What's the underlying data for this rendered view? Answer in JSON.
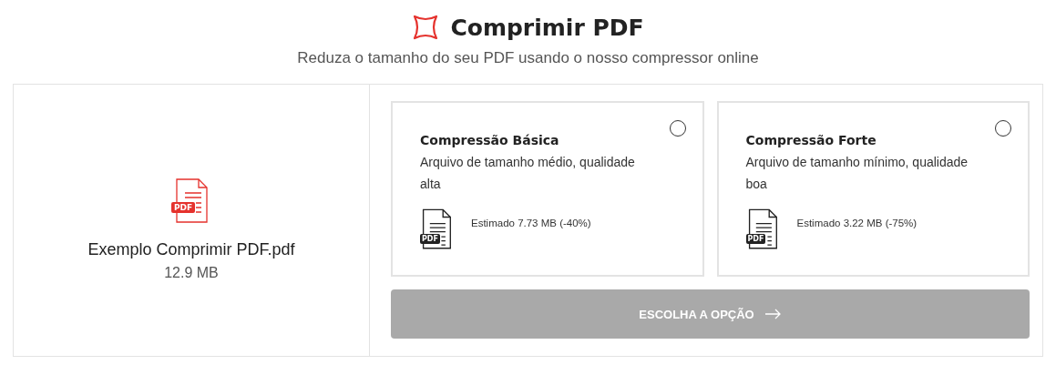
{
  "header": {
    "title": "Comprimir PDF",
    "subtitle": "Reduza o tamanho do seu PDF usando o nosso compressor online"
  },
  "file": {
    "badge": "PDF",
    "name": "Exemplo Comprimir PDF.pdf",
    "size": "12.9 MB"
  },
  "options": [
    {
      "title": "Compressão Básica",
      "description": "Arquivo de tamanho médio, qualidade alta",
      "badge": "PDF",
      "estimate": "Estimado 7.73 MB (-40%)",
      "selected": false
    },
    {
      "title": "Compressão Forte",
      "description": "Arquivo de tamanho mínimo, qualidade boa",
      "badge": "PDF",
      "estimate": "Estimado 3.22 MB (-75%)",
      "selected": false
    }
  ],
  "button": {
    "label": "ESCOLHA A OPÇÃO",
    "disabled": true
  }
}
